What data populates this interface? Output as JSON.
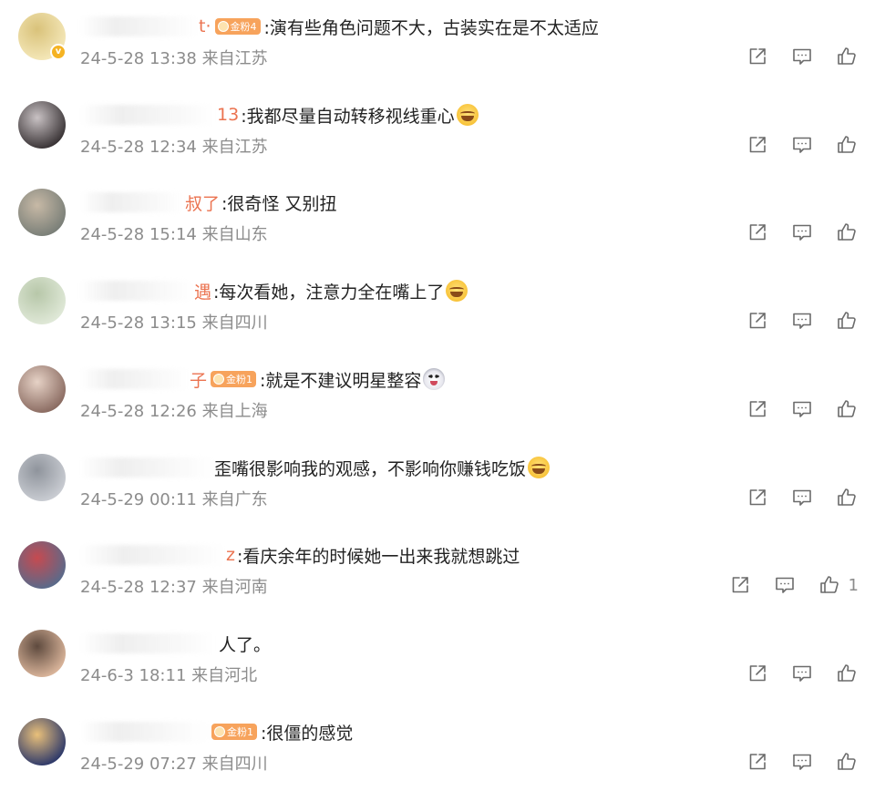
{
  "comments": [
    {
      "name_tail": "t·",
      "badge": "金粉4",
      "text": ":演有些角色问题不大，古装实在是不太适应",
      "emoji": "",
      "time": "24-5-28 13:38",
      "location": "来自江苏",
      "likes": "",
      "avatar_colors": [
        "#f4e7b8",
        "#d9c27a"
      ],
      "vip": true
    },
    {
      "name_tail": "13",
      "badge": "",
      "text": ":我都尽量自动转移视线重心",
      "emoji": "laugh",
      "time": "24-5-28 12:34",
      "location": "来自江苏",
      "likes": "",
      "avatar_colors": [
        "#3a3436",
        "#c9c2c4"
      ],
      "vip": false
    },
    {
      "name_tail": "叔了",
      "badge": "",
      "text": ":很奇怪 又别扭",
      "emoji": "",
      "time": "24-5-28 15:14",
      "location": "来自山东",
      "likes": "",
      "avatar_colors": [
        "#7a7f78",
        "#c7b9a6"
      ],
      "vip": false
    },
    {
      "name_tail": "遇",
      "badge": "",
      "text": ":每次看她，注意力全在嘴上了",
      "emoji": "laugh",
      "time": "24-5-28 13:15",
      "location": "来自四川",
      "likes": "",
      "avatar_colors": [
        "#dfe8d7",
        "#b7c7a9"
      ],
      "vip": false
    },
    {
      "name_tail": "子",
      "badge": "金粉1",
      "text": ":就是不建议明星整容",
      "emoji": "dog",
      "time": "24-5-28 12:26",
      "location": "来自上海",
      "likes": "",
      "avatar_colors": [
        "#8b6c62",
        "#e6d2c6"
      ],
      "vip": false
    },
    {
      "name_tail": "",
      "badge": "",
      "text": "歪嘴很影响我的观感，不影响你赚钱吃饭",
      "emoji": "laugh",
      "time": "24-5-29 00:11",
      "location": "来自广东",
      "likes": "",
      "avatar_colors": [
        "#c9ccd2",
        "#8f949c"
      ],
      "vip": false
    },
    {
      "name_tail": "z",
      "badge": "",
      "text": ":看庆余年的时候她一出来我就想跳过",
      "emoji": "",
      "time": "24-5-28 12:37",
      "location": "来自河南",
      "likes": "1",
      "avatar_colors": [
        "#5a6a8a",
        "#c64a50"
      ],
      "vip": false
    },
    {
      "name_tail": "",
      "badge": "",
      "text": "人了。",
      "emoji": "",
      "time": "24-6-3 18:11",
      "location": "来自河北",
      "likes": "",
      "avatar_colors": [
        "#d9b49a",
        "#5e4a3e"
      ],
      "vip": false
    },
    {
      "name_tail": "",
      "badge": "金粉1",
      "text": ":很僵的感觉",
      "emoji": "",
      "time": "24-5-29 07:27",
      "location": "来自四川",
      "likes": "",
      "avatar_colors": [
        "#2f3a6a",
        "#e9c07a"
      ],
      "vip": false
    }
  ],
  "icons": {
    "share": "share-icon",
    "comment": "comment-icon",
    "like": "like-icon"
  },
  "colors": {
    "name_accent": "#eb7350",
    "badge": "#f7a35c",
    "meta": "#8c8c8c",
    "icon": "#6b6b6b"
  }
}
